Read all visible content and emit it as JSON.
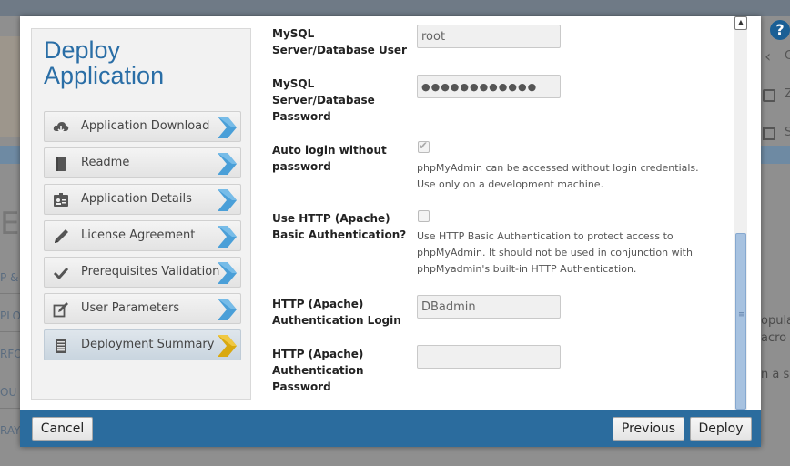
{
  "background": {
    "left_items": [
      "P &",
      "PLO",
      "RFO",
      "OU",
      "RAY"
    ],
    "big_letter": "EA",
    "help_label": "?",
    "right_items": [
      "C",
      "Z",
      "S"
    ],
    "right_text": [
      "opula",
      "acro",
      "n a si"
    ]
  },
  "sidebar": {
    "title": "Deploy Application",
    "steps": [
      {
        "label": "Application Download",
        "icon": "cloud-download-icon"
      },
      {
        "label": "Readme",
        "icon": "book-icon"
      },
      {
        "label": "Application Details",
        "icon": "id-card-icon"
      },
      {
        "label": "License Agreement",
        "icon": "pen-icon"
      },
      {
        "label": "Prerequisites Validation",
        "icon": "checkmark-icon"
      },
      {
        "label": "User Parameters",
        "icon": "edit-icon"
      },
      {
        "label": "Deployment Summary",
        "icon": "document-icon"
      }
    ],
    "active_step": "Deployment Summary"
  },
  "form": {
    "db_user": {
      "label": "MySQL Server/Database User",
      "value": "root"
    },
    "db_password": {
      "label": "MySQL Server/Database Password",
      "value": "●●●●●●●●●●●●"
    },
    "auto_login": {
      "label": "Auto login without password",
      "checked": true,
      "help": "phpMyAdmin can be accessed without login credentials. Use only on a development machine."
    },
    "http_auth": {
      "label": "Use HTTP (Apache) Basic Authentication?",
      "checked": false,
      "help": "Use HTTP Basic Authentication to protect access to phpMyAdmin. It should not be used in conjunction with phpMyadmin's built-in HTTP Authentication."
    },
    "http_login": {
      "label": "HTTP (Apache) Authentication Login",
      "value": "DBadmin"
    },
    "http_password": {
      "label": "HTTP (Apache) Authentication Password",
      "value": ""
    }
  },
  "footer": {
    "cancel_label": "Cancel",
    "previous_label": "Previous",
    "deploy_label": "Deploy"
  },
  "colors": {
    "accent": "#2b6c9e",
    "title": "#2a6ea6",
    "step_arrow_blue": "#4a9fd8",
    "step_arrow_gold": "#d9a90f"
  }
}
